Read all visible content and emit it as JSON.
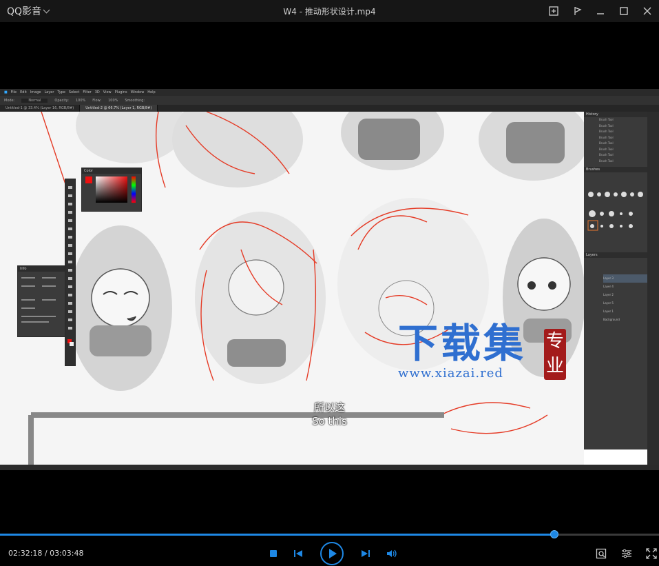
{
  "app": {
    "menu_label": "QQ影音",
    "window_title": "W4 - 推动形状设计.mp4"
  },
  "titlebar": {
    "icons": [
      "screenshot-icon",
      "pin-icon",
      "minimize-icon",
      "maximize-icon",
      "close-icon"
    ]
  },
  "video": {
    "photoshop": {
      "menu": [
        "File",
        "Edit",
        "Image",
        "Layer",
        "Type",
        "Select",
        "Filter",
        "3D",
        "View",
        "Plugins",
        "Window",
        "Help"
      ],
      "options": [
        "Mode:",
        "Normal",
        "Opacity:",
        "100%",
        "Flow:",
        "100%",
        "Smoothing:"
      ],
      "tabs": [
        "Untitled-1 @ 33.4% (Layer 16, RGB/8#)",
        "Untitled-2 @ 66.7% (Layer 1, RGB/8#)"
      ],
      "panels": {
        "color": "Color",
        "info": "Info",
        "history": "History",
        "brushes": "Brushes",
        "layers": "Layers"
      },
      "history_items": [
        "Brush Tool",
        "Brush Tool",
        "Brush Tool",
        "Brush Tool",
        "Brush Tool",
        "Brush Tool",
        "Brush Tool",
        "Brush Tool"
      ],
      "layers": [
        "Layer 3",
        "Layer 4",
        "Layer 2",
        "Layer 5",
        "Layer 1",
        "Background"
      ]
    },
    "subtitle": {
      "zh": "所以这",
      "en": "So this"
    },
    "watermark": {
      "text": "下载集",
      "seal": "专业",
      "url": "www.xiazai.red"
    }
  },
  "player": {
    "current_time": "02:32:18",
    "separator": " / ",
    "total_time": "03:03:48",
    "progress": 0.841,
    "accent": "#1e88e5",
    "controls": [
      "stop-icon",
      "previous-icon",
      "play-icon",
      "next-icon",
      "volume-icon",
      "capture-icon",
      "settings-icon",
      "fullscreen-icon"
    ]
  }
}
